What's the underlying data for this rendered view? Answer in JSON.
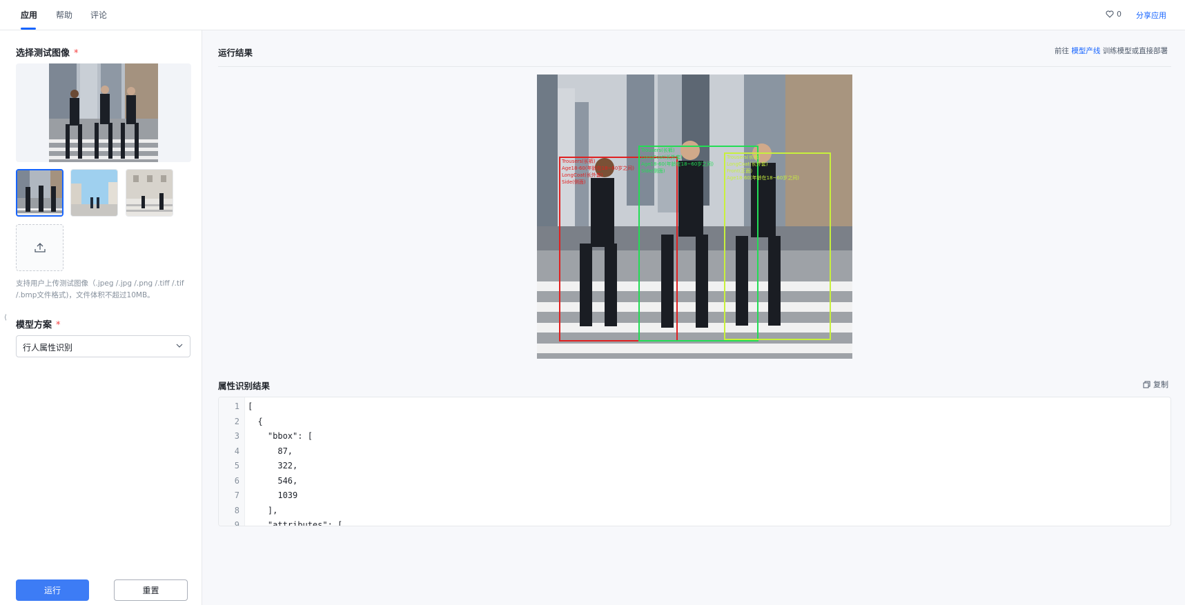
{
  "tabs": [
    {
      "label": "应用",
      "active": true
    },
    {
      "label": "帮助",
      "active": false
    },
    {
      "label": "评论",
      "active": false
    }
  ],
  "header": {
    "like_count": "0",
    "share_label": "分享应用"
  },
  "left": {
    "image_title": "选择测试图像",
    "required_mark": "*",
    "hint": "支持用户上传测试图像（.jpeg /.jpg /.png /.tiff /.tif /.bmp文件格式)，文件体积不超过10MB。",
    "model_title": "模型方案",
    "model_value": "行人属性识别",
    "run_label": "运行",
    "reset_label": "重置",
    "collapse_glyph": "⟨"
  },
  "result": {
    "title": "运行结果",
    "link_prefix": "前往",
    "link_text": "模型产线",
    "link_suffix": "训练模型或直接部署",
    "box_labels": [
      [
        "Trousers(长裤)",
        "Age18-60(年龄在18~60岁之间)",
        "LongCoat(长外套)",
        "Side(侧面)"
      ],
      [
        "Trousers(长裤)",
        "LongCoat(长外套)",
        "Age18-60(年龄在18~60岁之间)",
        "Side(侧面)"
      ],
      [
        "Trousers(长裤)",
        "LongCoat(长外套)",
        "Front(正面)",
        "Age18-60(年龄在18~60岁之间)"
      ]
    ]
  },
  "attr": {
    "title": "属性识别结果",
    "copy_label": "复制",
    "lines": [
      {
        "n": "1",
        "t": "["
      },
      {
        "n": "2",
        "t": "  {"
      },
      {
        "n": "3",
        "t": "    \"bbox\": ["
      },
      {
        "n": "4",
        "t": "      87,"
      },
      {
        "n": "5",
        "t": "      322,"
      },
      {
        "n": "6",
        "t": "      546,"
      },
      {
        "n": "7",
        "t": "      1039"
      },
      {
        "n": "8",
        "t": "    ],"
      },
      {
        "n": "9",
        "t": "    \"attributes\": ["
      }
    ]
  },
  "colors": {
    "accent": "#1664ff",
    "box_red": "#e02020",
    "box_green": "#22dd55",
    "box_yellow": "#c8f03c"
  }
}
